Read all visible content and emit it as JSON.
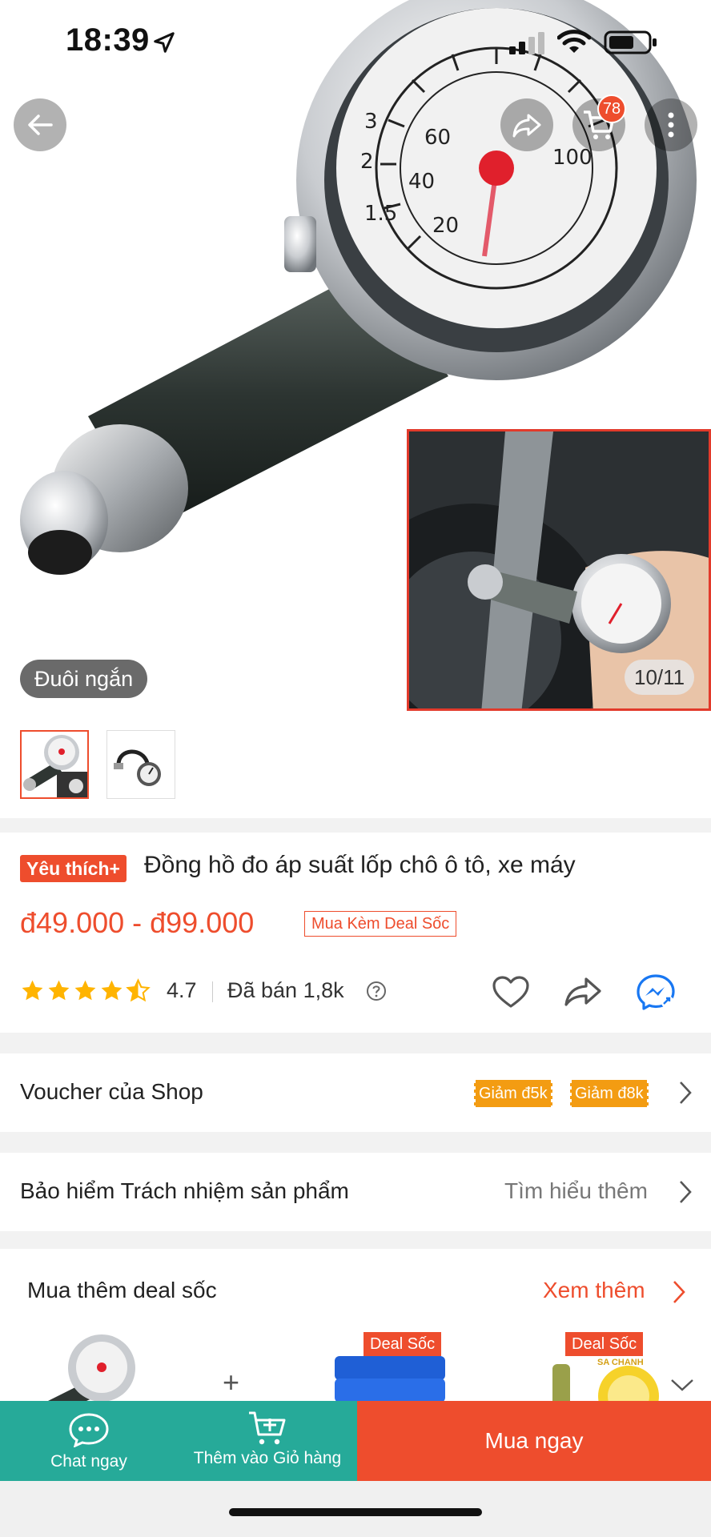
{
  "status_bar": {
    "time": "18:39"
  },
  "header": {
    "cart_count": "78"
  },
  "gallery": {
    "variant_label": "Đuôi ngắn",
    "page_counter": "10/11"
  },
  "product": {
    "badge": "Yêu thích+",
    "title": "Đồng hồ đo áp suất lốp chô ô tô, xe máy",
    "price": "đ49.000 - đ99.000",
    "deal_tag": "Mua Kèm Deal Sốc",
    "rating": "4.7",
    "rating_stars": 4.7,
    "sold": "Đã bán 1,8k"
  },
  "voucher_row": {
    "label": "Voucher của Shop",
    "vouchers": [
      "Giảm đ5k",
      "Giảm đ8k"
    ]
  },
  "insurance_row": {
    "label": "Bảo hiểm Trách nhiệm sản phẩm",
    "link": "Tìm hiểu thêm"
  },
  "deals": {
    "title": "Mua thêm deal sốc",
    "more": "Xem thêm",
    "items": [
      {
        "label": "Deal Sốc",
        "sub": "SA CHANH"
      },
      {
        "label": "Deal Sốc"
      }
    ],
    "plus": "+"
  },
  "bottom_bar": {
    "chat": "Chat ngay",
    "add_to_cart": "Thêm vào Giỏ hàng",
    "buy_now": "Mua ngay"
  },
  "colors": {
    "brand": "#ee4d2d",
    "teal": "#26aa99",
    "voucher": "#f39c12"
  }
}
